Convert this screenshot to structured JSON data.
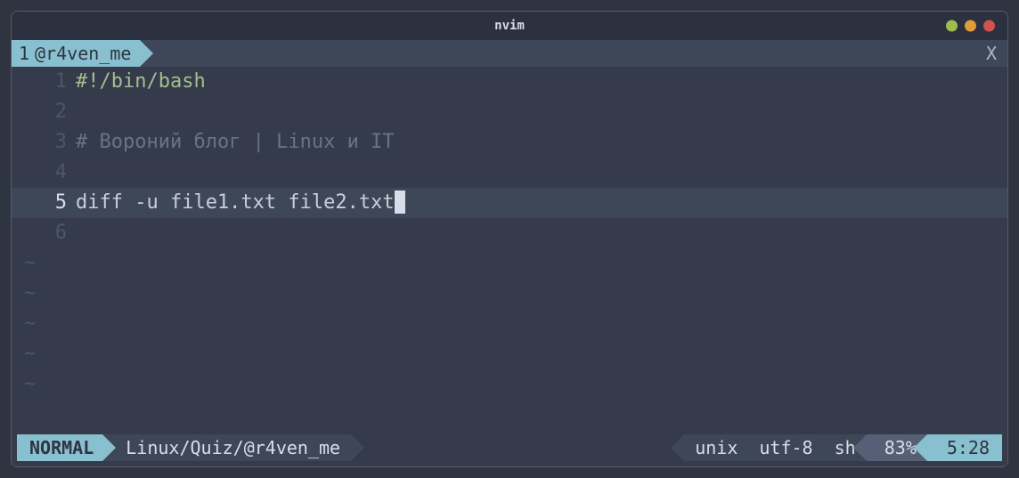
{
  "window": {
    "title": "nvim"
  },
  "tabbar": {
    "tab": {
      "index": "1",
      "name": "@r4ven_me"
    },
    "close_label": "X"
  },
  "editor": {
    "lines": [
      {
        "num": "1",
        "cls": "comment-green",
        "text": "#!/bin/bash"
      },
      {
        "num": "2",
        "cls": "",
        "text": ""
      },
      {
        "num": "3",
        "cls": "comment-gray",
        "text": "# Вороний блог | Linux и IT"
      },
      {
        "num": "4",
        "cls": "",
        "text": ""
      },
      {
        "num": "5",
        "cls": "code-fg",
        "text": "diff -u file1.txt file2.txt",
        "current": true,
        "cursor": true
      },
      {
        "num": "6",
        "cls": "",
        "text": ""
      }
    ],
    "tilde": "~"
  },
  "status": {
    "mode": "NORMAL",
    "path": "Linux/Quiz/@r4ven_me",
    "fileformat": "unix",
    "encoding": "utf-8",
    "filetype": "sh",
    "percent": "83%",
    "position": "5:28"
  }
}
